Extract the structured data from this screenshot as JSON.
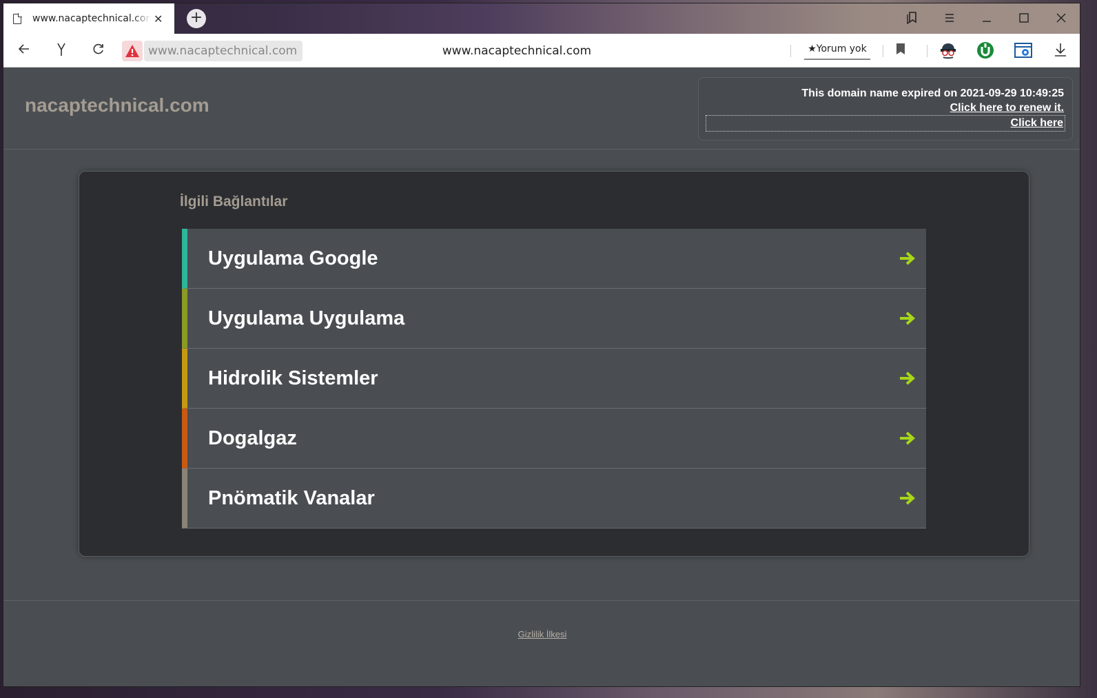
{
  "browser": {
    "tab_title": "www.nacaptechnical.com",
    "tab_close": "✕",
    "new_tab": "+",
    "address_url": "www.nacaptechnical.com",
    "address_center": "www.nacaptechnical.com",
    "review_label": "★Yorum yok"
  },
  "site": {
    "name": "nacaptechnical.com",
    "expire_notice": "This domain name expired on 2021-09-29 10:49:25",
    "renew_link": "Click here to renew it.",
    "click_here": "Click here"
  },
  "related": {
    "title": "İlgili Bağlantılar",
    "items": [
      {
        "label": "Uygulama Google",
        "accent": "#2fb59a"
      },
      {
        "label": "Uygulama Uygulama",
        "accent": "#8a9a24"
      },
      {
        "label": "Hidrolik Sistemler",
        "accent": "#c49a12"
      },
      {
        "label": "Dogalgaz",
        "accent": "#c85a12"
      },
      {
        "label": "Pnömatik Vanalar",
        "accent": "#8a8276"
      }
    ],
    "arrow_color": "#a6d61a"
  },
  "footer": {
    "privacy": "Gizlilik İlkesi"
  }
}
